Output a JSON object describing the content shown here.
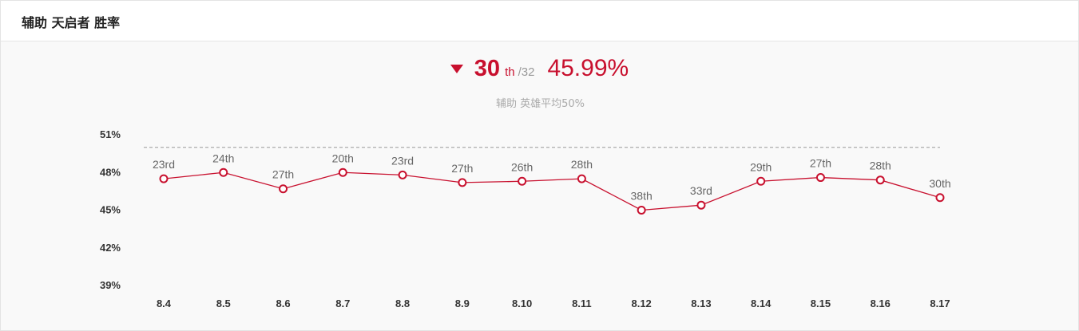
{
  "header": {
    "title": "辅助 天启者 胜率"
  },
  "summary": {
    "rank": "30",
    "rank_suffix": "th",
    "rank_total": "/32",
    "win_rate": "45.99%",
    "trend_icon": "down-triangle-icon",
    "subtitle": "辅助 英雄平均50%"
  },
  "colors": {
    "accent": "#c8102e",
    "reference_line": "#999999",
    "tick_text": "#333333",
    "label_text": "#666666"
  },
  "chart_data": {
    "type": "line",
    "title": "",
    "xlabel": "",
    "ylabel": "",
    "ylim": [
      39,
      51
    ],
    "y_ticks": [
      "51%",
      "48%",
      "45%",
      "42%",
      "39%"
    ],
    "y_tick_values": [
      51,
      48,
      45,
      42,
      39
    ],
    "reference_line": 50,
    "categories": [
      "8.4",
      "8.5",
      "8.6",
      "8.7",
      "8.8",
      "8.9",
      "8.10",
      "8.11",
      "8.12",
      "8.13",
      "8.14",
      "8.15",
      "8.16",
      "8.17"
    ],
    "series": [
      {
        "values": [
          47.5,
          48.0,
          46.7,
          48.0,
          47.8,
          47.2,
          47.3,
          47.5,
          45.0,
          45.4,
          47.3,
          47.6,
          47.4,
          46.0
        ],
        "labels": [
          "23rd",
          "24th",
          "27th",
          "20th",
          "23rd",
          "27th",
          "26th",
          "28th",
          "38th",
          "33rd",
          "29th",
          "27th",
          "28th",
          "30th"
        ]
      }
    ],
    "grid": false,
    "legend": "none"
  }
}
